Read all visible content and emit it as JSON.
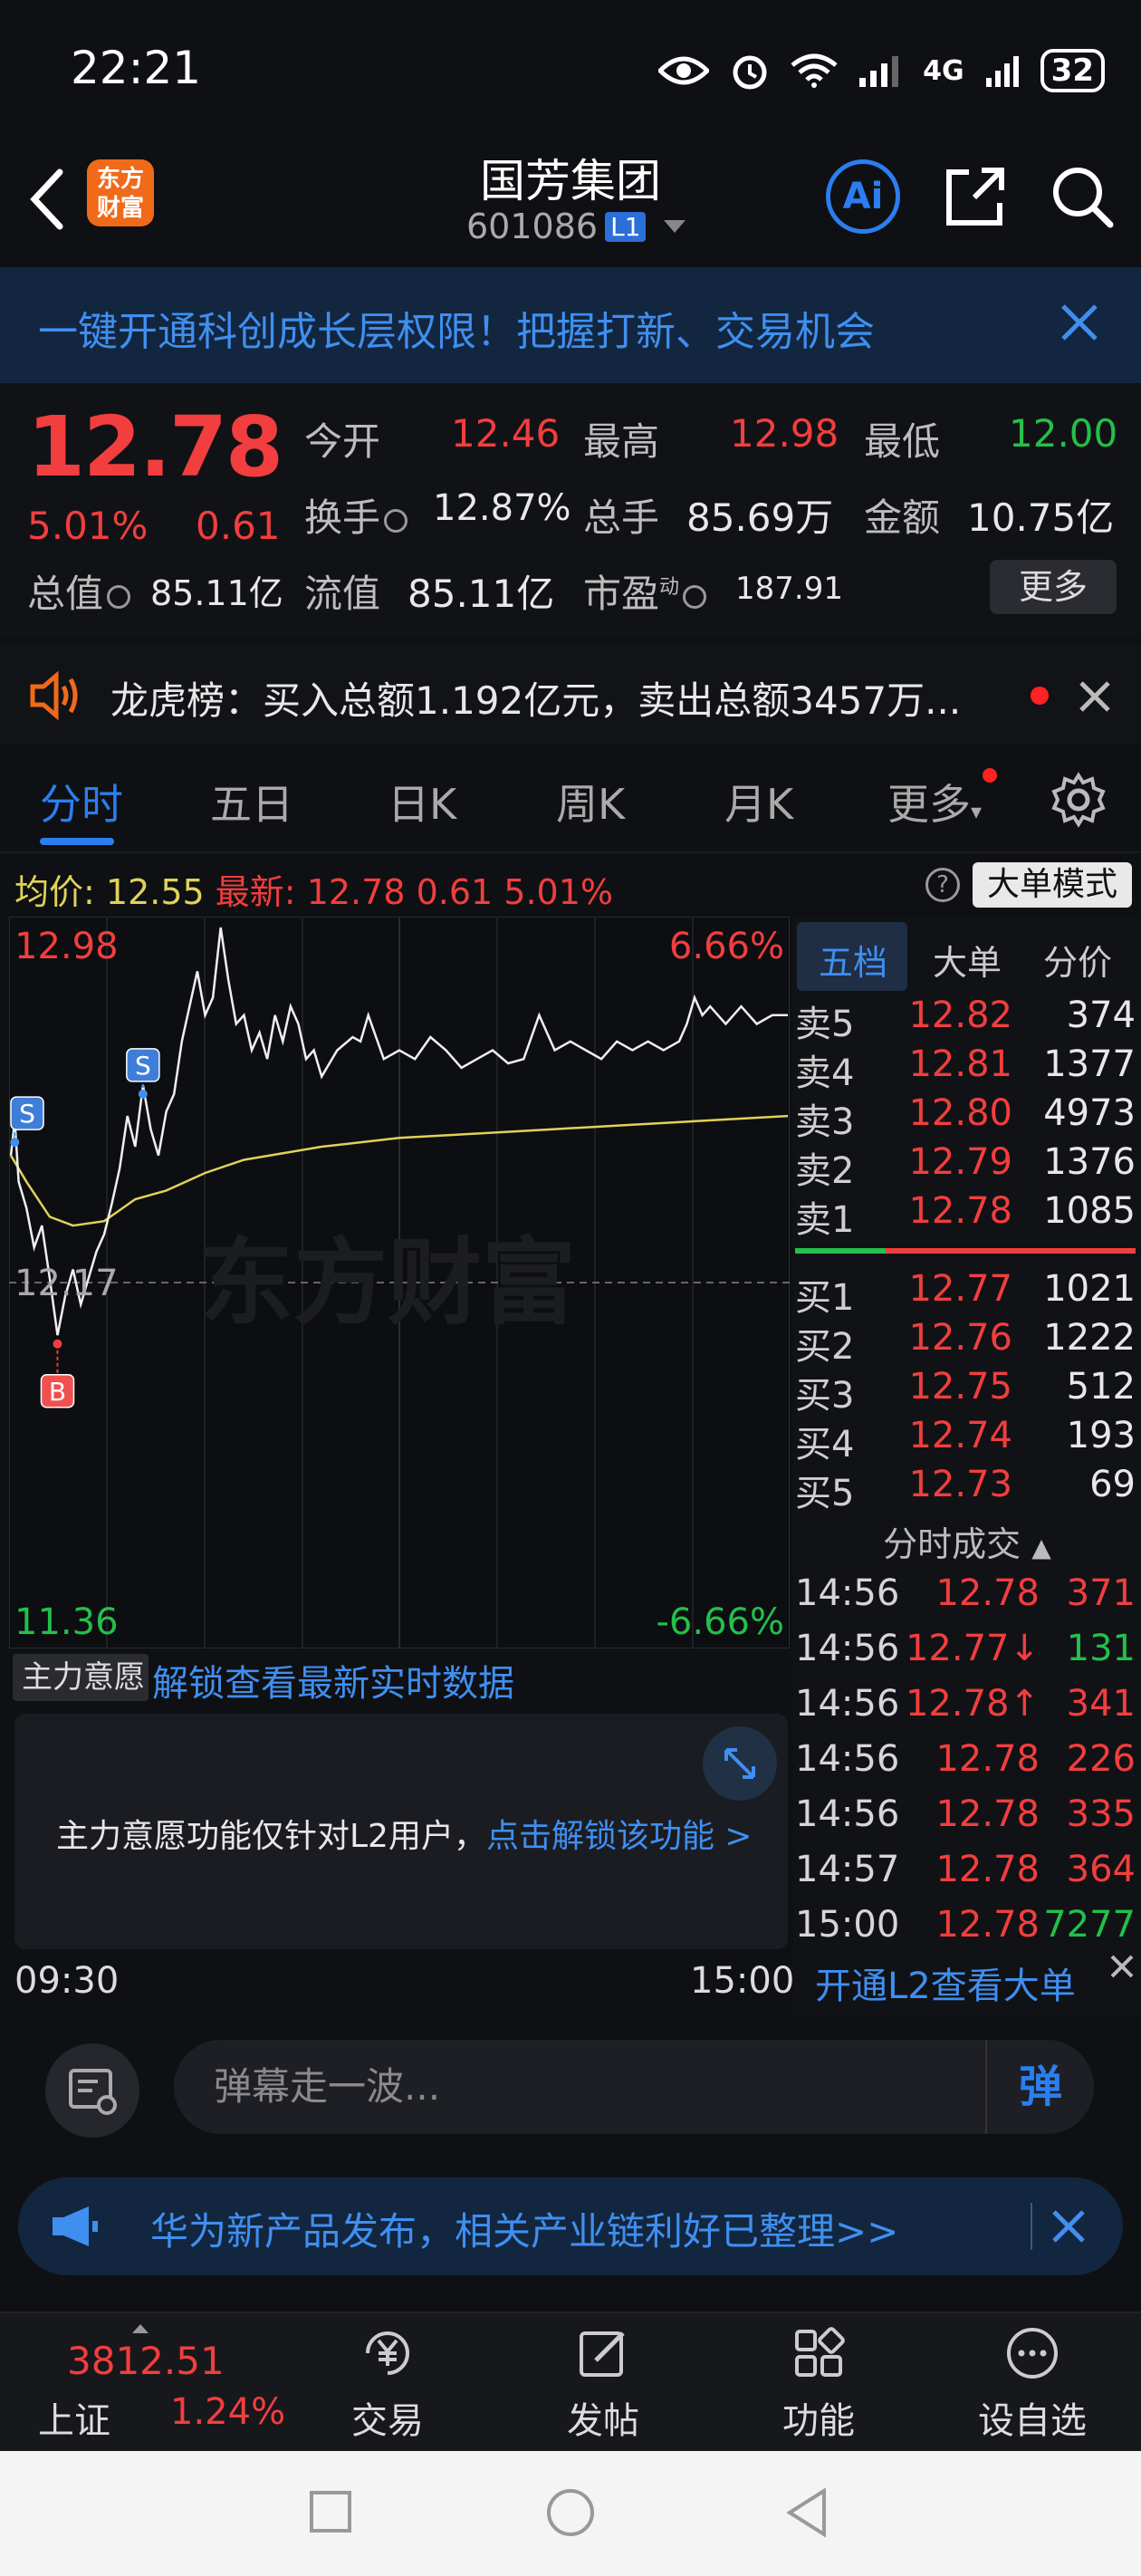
{
  "status_bar": {
    "time": "22:21",
    "network": "4G",
    "battery": "32"
  },
  "header": {
    "logo_line1": "东方",
    "logo_line2": "财富",
    "stock_name": "国芳集团",
    "stock_code": "601086",
    "level_badge": "L1",
    "ai_label": "Ai"
  },
  "promo_banner": {
    "text": "一键开通科创成长层权限！把握打新、交易机会"
  },
  "quote": {
    "price": "12.78",
    "pct_change": "5.01%",
    "abs_change": "0.61",
    "open_label": "今开",
    "open": "12.46",
    "high_label": "最高",
    "high": "12.98",
    "low_label": "最低",
    "low": "12.00",
    "turnover_label": "换手",
    "turnover": "12.87%",
    "volume_label": "总手",
    "volume": "85.69万",
    "amount_label": "金额",
    "amount": "10.75亿",
    "mktcap_label": "总值",
    "mktcap": "85.11亿",
    "float_label": "流值",
    "float_cap": "85.11亿",
    "pe_label": "市盈",
    "pe_sup": "动",
    "pe": "187.91",
    "more_label": "更多"
  },
  "dragon_tiger": {
    "text": "龙虎榜：买入总额1.192亿元，卖出总额3457万..."
  },
  "tabs": [
    "分时",
    "五日",
    "日K",
    "周K",
    "月K",
    "更多"
  ],
  "avg_bar": {
    "avg_label": "均价:",
    "avg_value": "12.55",
    "latest_label": "最新:",
    "latest_price": "12.78",
    "latest_change": "0.61",
    "latest_pct": "5.01%",
    "mode_button": "大单模式"
  },
  "chart_data": {
    "type": "line",
    "title": "",
    "y_top_label": "12.98",
    "y_mid_label": "12.17",
    "y_bottom_label": "11.36",
    "pct_top_label": "6.66%",
    "pct_bottom_label": "-6.66%",
    "ylim": [
      11.36,
      12.98
    ],
    "prev_close": 12.17,
    "watermark": "东方财富",
    "markers": [
      {
        "label": "S",
        "x": 0.005,
        "y": 12.49
      },
      {
        "label": "S",
        "x": 0.17,
        "y": 12.6
      },
      {
        "label": "B",
        "x": 0.06,
        "y": 12.03
      }
    ],
    "price_series": [
      [
        0.0,
        12.46
      ],
      [
        0.005,
        12.54
      ],
      [
        0.01,
        12.4
      ],
      [
        0.02,
        12.34
      ],
      [
        0.03,
        12.25
      ],
      [
        0.04,
        12.3
      ],
      [
        0.05,
        12.18
      ],
      [
        0.06,
        12.05
      ],
      [
        0.07,
        12.14
      ],
      [
        0.08,
        12.2
      ],
      [
        0.09,
        12.12
      ],
      [
        0.1,
        12.18
      ],
      [
        0.11,
        12.24
      ],
      [
        0.12,
        12.28
      ],
      [
        0.13,
        12.35
      ],
      [
        0.14,
        12.43
      ],
      [
        0.15,
        12.55
      ],
      [
        0.16,
        12.48
      ],
      [
        0.17,
        12.62
      ],
      [
        0.18,
        12.52
      ],
      [
        0.19,
        12.46
      ],
      [
        0.2,
        12.56
      ],
      [
        0.21,
        12.6
      ],
      [
        0.22,
        12.72
      ],
      [
        0.23,
        12.8
      ],
      [
        0.24,
        12.88
      ],
      [
        0.25,
        12.78
      ],
      [
        0.26,
        12.82
      ],
      [
        0.27,
        12.98
      ],
      [
        0.28,
        12.86
      ],
      [
        0.29,
        12.76
      ],
      [
        0.3,
        12.78
      ],
      [
        0.31,
        12.7
      ],
      [
        0.32,
        12.74
      ],
      [
        0.33,
        12.68
      ],
      [
        0.34,
        12.78
      ],
      [
        0.35,
        12.72
      ],
      [
        0.36,
        12.8
      ],
      [
        0.37,
        12.76
      ],
      [
        0.38,
        12.68
      ],
      [
        0.39,
        12.7
      ],
      [
        0.4,
        12.64
      ],
      [
        0.42,
        12.7
      ],
      [
        0.44,
        12.73
      ],
      [
        0.45,
        12.72
      ],
      [
        0.46,
        12.78
      ],
      [
        0.48,
        12.68
      ],
      [
        0.5,
        12.7
      ],
      [
        0.52,
        12.68
      ],
      [
        0.54,
        12.73
      ],
      [
        0.56,
        12.7
      ],
      [
        0.58,
        12.66
      ],
      [
        0.6,
        12.68
      ],
      [
        0.62,
        12.7
      ],
      [
        0.64,
        12.67
      ],
      [
        0.66,
        12.68
      ],
      [
        0.68,
        12.78
      ],
      [
        0.7,
        12.7
      ],
      [
        0.72,
        12.72
      ],
      [
        0.74,
        12.7
      ],
      [
        0.76,
        12.68
      ],
      [
        0.78,
        12.72
      ],
      [
        0.8,
        12.7
      ],
      [
        0.82,
        12.72
      ],
      [
        0.84,
        12.7
      ],
      [
        0.86,
        12.72
      ],
      [
        0.87,
        12.76
      ],
      [
        0.88,
        12.82
      ],
      [
        0.89,
        12.78
      ],
      [
        0.9,
        12.8
      ],
      [
        0.92,
        12.76
      ],
      [
        0.94,
        12.8
      ],
      [
        0.96,
        12.76
      ],
      [
        0.98,
        12.78
      ],
      [
        1.0,
        12.78
      ]
    ],
    "avg_series": [
      [
        0.0,
        12.46
      ],
      [
        0.02,
        12.4
      ],
      [
        0.05,
        12.32
      ],
      [
        0.08,
        12.3
      ],
      [
        0.12,
        12.31
      ],
      [
        0.16,
        12.36
      ],
      [
        0.2,
        12.38
      ],
      [
        0.25,
        12.42
      ],
      [
        0.3,
        12.45
      ],
      [
        0.4,
        12.48
      ],
      [
        0.5,
        12.5
      ],
      [
        0.6,
        12.51
      ],
      [
        0.7,
        12.52
      ],
      [
        0.8,
        12.53
      ],
      [
        0.9,
        12.54
      ],
      [
        1.0,
        12.55
      ]
    ]
  },
  "right_panel": {
    "tabs": [
      "五档",
      "大单",
      "分价"
    ],
    "asks": [
      {
        "label": "卖5",
        "price": "12.82",
        "vol": "374"
      },
      {
        "label": "卖4",
        "price": "12.81",
        "vol": "1377"
      },
      {
        "label": "卖3",
        "price": "12.80",
        "vol": "4973"
      },
      {
        "label": "卖2",
        "price": "12.79",
        "vol": "1376"
      },
      {
        "label": "卖1",
        "price": "12.78",
        "vol": "1085"
      }
    ],
    "bids": [
      {
        "label": "买1",
        "price": "12.77",
        "vol": "1021"
      },
      {
        "label": "买2",
        "price": "12.76",
        "vol": "1222"
      },
      {
        "label": "买3",
        "price": "12.75",
        "vol": "512"
      },
      {
        "label": "买4",
        "price": "12.74",
        "vol": "193"
      },
      {
        "label": "买5",
        "price": "12.73",
        "vol": "69"
      }
    ],
    "trades_header": "分时成交",
    "trades": [
      {
        "time": "14:56",
        "price": "12.78",
        "vol": "371",
        "dir": "sell"
      },
      {
        "time": "14:56",
        "price": "12.77↓",
        "vol": "131",
        "dir": "buy"
      },
      {
        "time": "14:56",
        "price": "12.78↑",
        "vol": "341",
        "dir": "sell"
      },
      {
        "time": "14:56",
        "price": "12.78",
        "vol": "226",
        "dir": "sell"
      },
      {
        "time": "14:56",
        "price": "12.78",
        "vol": "335",
        "dir": "sell"
      },
      {
        "time": "14:57",
        "price": "12.78",
        "vol": "364",
        "dir": "sell"
      },
      {
        "time": "15:00",
        "price": "12.78",
        "vol": "7277",
        "dir": "buy"
      }
    ],
    "l2_link": "开通L2查看大单"
  },
  "main_force": {
    "selector": "主力意愿",
    "unlock_link": "解锁查看最新实时数据",
    "notice": "主力意愿功能仅针对L2用户，",
    "notice_link": "点击解锁该功能 >",
    "time_start": "09:30",
    "time_end": "15:00"
  },
  "danmaku": {
    "placeholder": "弹幕走一波...",
    "send": "弹"
  },
  "news_banner": {
    "text": "华为新产品发布，相关产业链利好已整理>>"
  },
  "bottom_bar": {
    "index_value": "3812.51",
    "index_name": "上证",
    "index_pct": "1.24%",
    "items": [
      "交易",
      "发帖",
      "功能",
      "设自选"
    ]
  },
  "colors": {
    "up": "#f23e3e",
    "down": "#23c04a",
    "accent": "#2a7ef0",
    "avg_line": "#e0d25a"
  }
}
